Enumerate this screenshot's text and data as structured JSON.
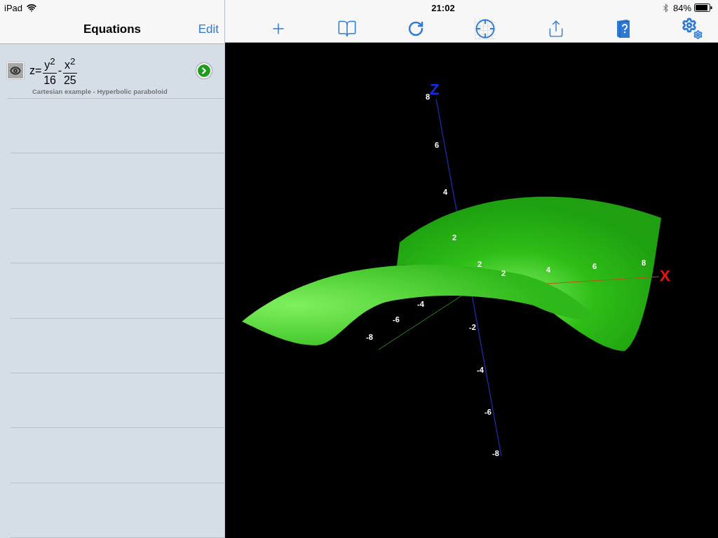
{
  "status_bar": {
    "device": "iPad",
    "time": "21:02",
    "battery": "84%"
  },
  "sidebar": {
    "title": "Equations",
    "edit_button": "Edit",
    "equations": [
      {
        "prefix": "z=",
        "operator": "-",
        "fractions": [
          {
            "numerator": "y$^{2}$",
            "denominator": "16"
          },
          {
            "numerator": "x$^{2}$",
            "denominator": "25"
          }
        ],
        "caption": "Cartesian example - Hyperbolic paraboloid"
      }
    ]
  },
  "plot": {
    "axis_labels": [
      "Z",
      "X"
    ],
    "z_ticks": [
      "8",
      "6",
      "4",
      "2",
      "-2",
      "-4",
      "-6",
      "-8"
    ],
    "x_ticks": [
      "2",
      "4",
      "6",
      "8"
    ],
    "y_ticks": [
      "2",
      "-4",
      "-6",
      "-8"
    ]
  }
}
